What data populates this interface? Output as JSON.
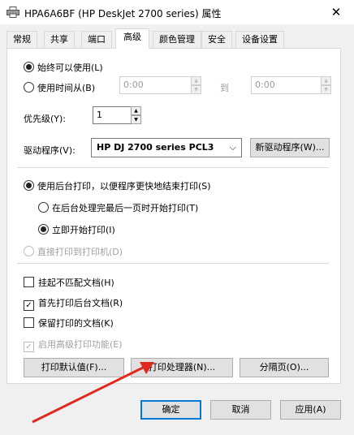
{
  "window": {
    "title": "HPA6A6BF (HP DeskJet 2700 series) 属性",
    "close_glyph": "✕"
  },
  "tabs": [
    {
      "label": "常规"
    },
    {
      "label": "共享"
    },
    {
      "label": "端口"
    },
    {
      "label": "高级"
    },
    {
      "label": "颜色管理"
    },
    {
      "label": "安全"
    },
    {
      "label": "设备设置"
    }
  ],
  "active_tab": "高级",
  "availability": {
    "always_label": "始终可以使用(L)",
    "from_label": "使用时间从(B)",
    "from_value": "0:00",
    "to_label": "到",
    "to_value": "0:00"
  },
  "priority": {
    "label": "优先级(Y):",
    "value": "1"
  },
  "driver": {
    "label": "驱动程序(V):",
    "value": "HP DJ 2700 series PCL3",
    "new_driver_button": "新驱动程序(W)..."
  },
  "spool": {
    "spool_label": "使用后台打印，以便程序更快地结束打印(S)",
    "after_last_page_label": "在后台处理完最后一页时开始打印(T)",
    "immediately_label": "立即开始打印(I)",
    "direct_label": "直接打印到打印机(D)"
  },
  "options": {
    "hold_mismatched": "挂起不匹配文档(H)",
    "print_spooled_first": "首先打印后台文档(R)",
    "keep_printed": "保留打印的文档(K)",
    "enable_advanced": "启用高级打印功能(E)"
  },
  "panel_buttons": {
    "defaults": "打印默认值(F)...",
    "processor": "打印处理器(N)...",
    "separator": "分隔页(O)..."
  },
  "dialog_buttons": {
    "ok": "确定",
    "cancel": "取消",
    "apply": "应用(A)"
  },
  "colors": {
    "accent": "#0078d7",
    "annotation_arrow": "#e0291e"
  }
}
